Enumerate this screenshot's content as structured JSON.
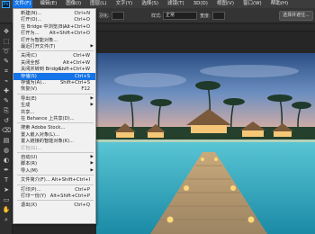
{
  "menubar": {
    "logo": "Ps",
    "items": [
      {
        "label": "文件(F)",
        "active": true
      },
      {
        "label": "编辑(E)"
      },
      {
        "label": "图像(I)"
      },
      {
        "label": "图层(L)"
      },
      {
        "label": "文字(Y)"
      },
      {
        "label": "选择(S)"
      },
      {
        "label": "滤镜(T)"
      },
      {
        "label": "3D(D)"
      },
      {
        "label": "视图(V)"
      },
      {
        "label": "窗口(W)"
      },
      {
        "label": "帮助(H)"
      }
    ]
  },
  "options": {
    "feather_label": "羽化:",
    "style_label": "样式:",
    "style_value": "正常",
    "width_label": "宽度:",
    "select_mask_label": "选择并遮住..."
  },
  "file_menu": {
    "items": [
      {
        "label": "新建(N)...",
        "shortcut": "Ctrl+N"
      },
      {
        "label": "打开(O)...",
        "shortcut": "Ctrl+O"
      },
      {
        "label": "在 Bridge 中浏览(B)...",
        "shortcut": "Alt+Ctrl+O"
      },
      {
        "label": "打开为...",
        "shortcut": "Alt+Shift+Ctrl+O"
      },
      {
        "label": "打开为智能对象..."
      },
      {
        "label": "最近打开文件(T)",
        "submenu": true
      },
      {
        "sep": true
      },
      {
        "label": "关闭(C)",
        "shortcut": "Ctrl+W"
      },
      {
        "label": "关闭全部",
        "shortcut": "Alt+Ctrl+W"
      },
      {
        "label": "关闭并转到 Bridge...",
        "shortcut": "Shift+Ctrl+W"
      },
      {
        "label": "存储(S)",
        "shortcut": "Ctrl+S",
        "highlighted": true
      },
      {
        "label": "存储为(A)...",
        "shortcut": "Shift+Ctrl+S"
      },
      {
        "label": "恢复(V)",
        "shortcut": "F12"
      },
      {
        "sep": true
      },
      {
        "label": "导出(E)",
        "submenu": true
      },
      {
        "label": "生成",
        "submenu": true
      },
      {
        "label": "共享..."
      },
      {
        "label": "在 Behance 上共享(D)..."
      },
      {
        "sep": true
      },
      {
        "label": "搜索 Adobe Stock..."
      },
      {
        "label": "置入嵌入对象(L)..."
      },
      {
        "label": "置入链接的智能对象(K)..."
      },
      {
        "label": "打包(G)...",
        "disabled": true
      },
      {
        "sep": true
      },
      {
        "label": "自动(U)",
        "submenu": true
      },
      {
        "label": "脚本(R)",
        "submenu": true
      },
      {
        "label": "导入(M)",
        "submenu": true
      },
      {
        "sep": true
      },
      {
        "label": "文件简介(F)...",
        "shortcut": "Alt+Shift+Ctrl+I"
      },
      {
        "sep": true
      },
      {
        "label": "打印(P)...",
        "shortcut": "Ctrl+P"
      },
      {
        "label": "打印一份(Y)",
        "shortcut": "Alt+Shift+Ctrl+P"
      },
      {
        "sep": true
      },
      {
        "label": "退出(X)",
        "shortcut": "Ctrl+Q"
      }
    ]
  },
  "tools": [
    "move-icon",
    "marquee-icon",
    "lasso-icon",
    "quick-select-icon",
    "crop-icon",
    "eyedropper-icon",
    "healing-icon",
    "brush-icon",
    "stamp-icon",
    "history-brush-icon",
    "eraser-icon",
    "gradient-icon",
    "blur-icon",
    "dodge-icon",
    "pen-icon",
    "type-icon",
    "path-select-icon",
    "shape-icon",
    "hand-icon",
    "zoom-icon"
  ]
}
